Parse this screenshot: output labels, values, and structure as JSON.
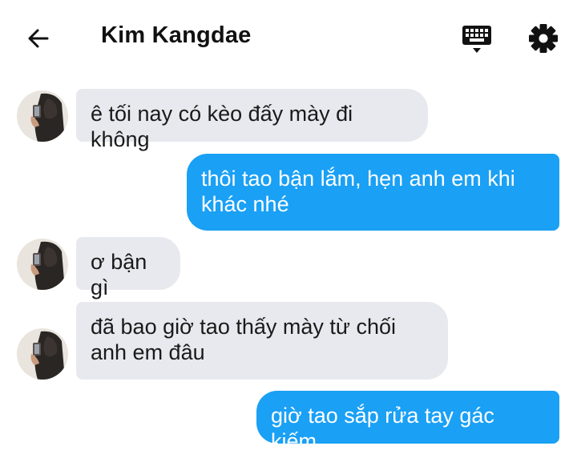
{
  "header": {
    "contact_name": "Kim Kangdae",
    "icons": [
      "back-arrow-icon",
      "keyboard-icon",
      "gear-icon"
    ]
  },
  "colors": {
    "incoming_bubble": "#e8e9ee",
    "outgoing_bubble": "#1aa0f5"
  },
  "messages": [
    {
      "direction": "incoming",
      "text": "ê tối nay có kèo đấy mày đi không"
    },
    {
      "direction": "outgoing",
      "text": "thôi tao bận lắm, hẹn anh em khi khác nhé"
    },
    {
      "direction": "incoming",
      "text": "ơ bận gì"
    },
    {
      "direction": "incoming",
      "text": "đã bao giờ tao thấy mày từ chối anh em đâu"
    },
    {
      "direction": "outgoing",
      "text": "giờ tao sắp rửa tay gác kiếm"
    }
  ]
}
